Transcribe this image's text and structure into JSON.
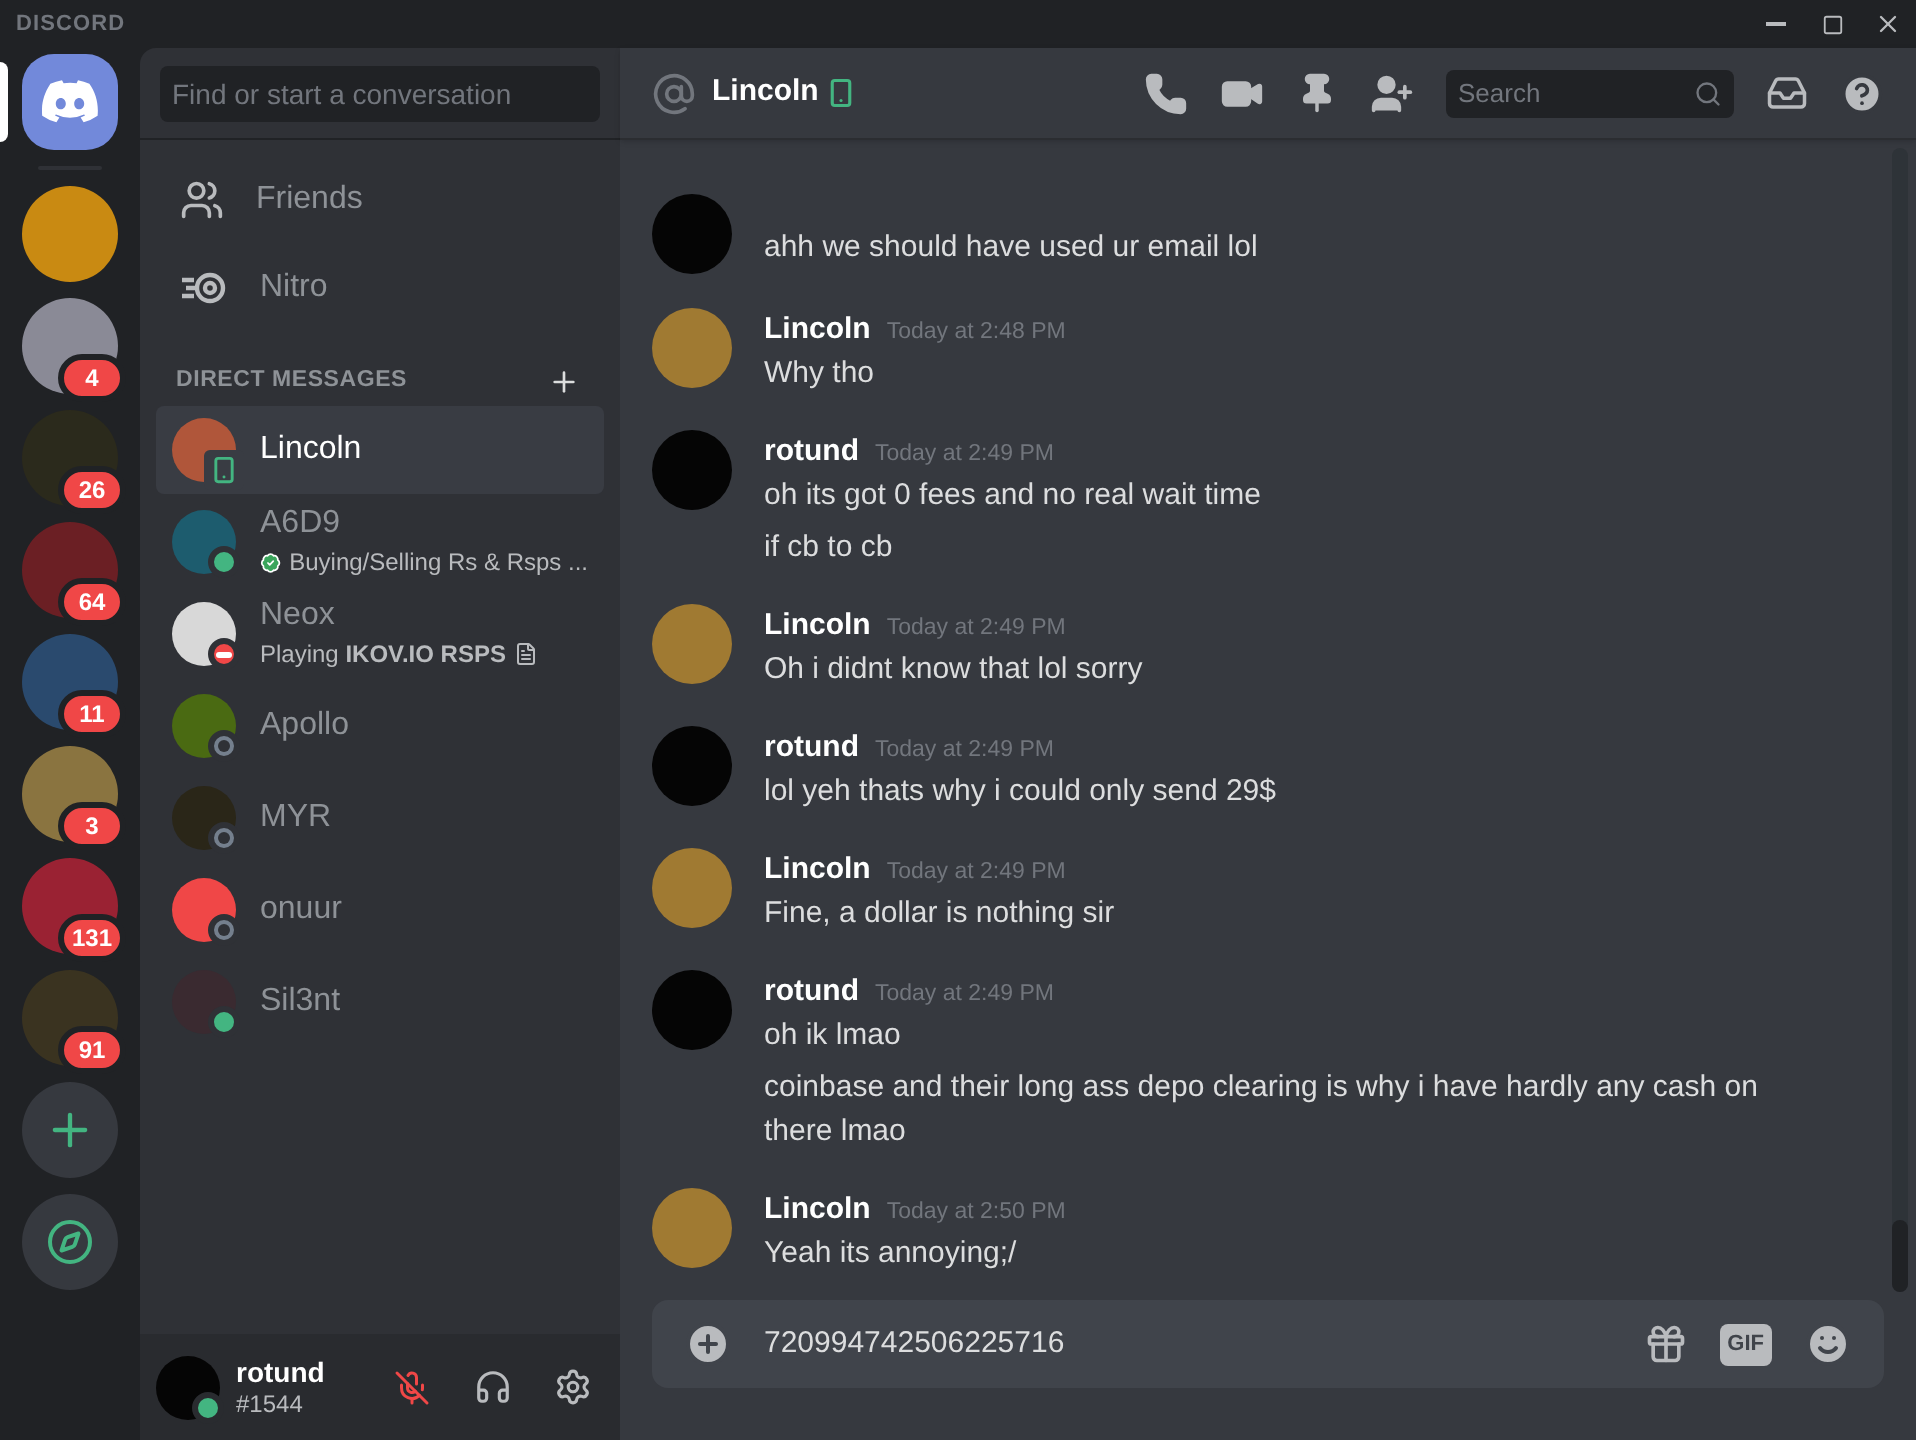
{
  "app_title": "DISCORD",
  "servers": [
    {
      "kind": "home",
      "selected": true
    },
    {
      "kind": "server",
      "color": "#c98a12"
    },
    {
      "kind": "server",
      "badge": "4",
      "color": "#8a8a96"
    },
    {
      "kind": "server",
      "badge": "26",
      "color": "#2b2a1c"
    },
    {
      "kind": "server",
      "badge": "64",
      "color": "#6b1f24"
    },
    {
      "kind": "server",
      "badge": "11",
      "color": "#2a4a6e"
    },
    {
      "kind": "server",
      "badge": "3",
      "color": "#8a7440"
    },
    {
      "kind": "server",
      "badge": "131",
      "color": "#9a2233"
    },
    {
      "kind": "server",
      "badge": "91",
      "color": "#3a3320"
    },
    {
      "kind": "add"
    },
    {
      "kind": "explore"
    }
  ],
  "dm_search": {
    "placeholder": "Find or start a conversation"
  },
  "nav": [
    {
      "kind": "friends",
      "label": "Friends"
    },
    {
      "kind": "nitro",
      "label": "Nitro"
    }
  ],
  "dm_header": "DIRECT MESSAGES",
  "dms": [
    {
      "name": "Lincoln",
      "selected": true,
      "status": {
        "kind": "mobile"
      },
      "color": "#b0563a"
    },
    {
      "name": "A6D9",
      "selected": false,
      "status": {
        "kind": "online"
      },
      "activity": {
        "text": "Buying/Selling Rs & Rsps ...",
        "kind": "verified"
      },
      "color": "#1d5c6e"
    },
    {
      "name": "Neox",
      "selected": false,
      "status": {
        "kind": "dnd"
      },
      "activity": {
        "text": "Playing **IKOV.IO RSPS**",
        "kind": "game"
      },
      "color": "#d8d8d8"
    },
    {
      "name": "Apollo",
      "selected": false,
      "status": {
        "kind": "offline"
      },
      "color": "#4a6a12"
    },
    {
      "name": "MYR",
      "selected": false,
      "status": {
        "kind": "offline"
      },
      "color": "#2a2618"
    },
    {
      "name": "onuur",
      "selected": false,
      "status": {
        "kind": "offline"
      },
      "color": "#f04747"
    },
    {
      "name": "Sil3nt",
      "selected": false,
      "status": {
        "kind": "online"
      },
      "color": "#3a2a30"
    }
  ],
  "user": {
    "name": "rotund",
    "tag": "#1544",
    "status": {
      "kind": "online"
    },
    "mic_muted": true
  },
  "channel": {
    "name": "Lincoln",
    "status": {
      "kind": "mobile"
    }
  },
  "search": {
    "placeholder": "Search"
  },
  "messages": [
    {
      "color": "#050505",
      "lines": [
        "ahh we should have used ur email lol"
      ]
    },
    {
      "author": "Lincoln",
      "color": "#a07a32",
      "time": "Today at 2:48 PM",
      "lines": [
        "Why tho"
      ]
    },
    {
      "author": "rotund",
      "color": "#050505",
      "time": "Today at 2:49 PM",
      "lines": [
        "oh its got 0 fees and no real wait time",
        "if cb to cb"
      ]
    },
    {
      "author": "Lincoln",
      "color": "#a07a32",
      "time": "Today at 2:49 PM",
      "lines": [
        "Oh i didnt know that lol sorry"
      ]
    },
    {
      "author": "rotund",
      "color": "#050505",
      "time": "Today at 2:49 PM",
      "lines": [
        "lol yeh thats why i could only send 29$"
      ]
    },
    {
      "author": "Lincoln",
      "color": "#a07a32",
      "time": "Today at 2:49 PM",
      "lines": [
        "Fine, a dollar is nothing sir"
      ]
    },
    {
      "author": "rotund",
      "color": "#050505",
      "time": "Today at 2:49 PM",
      "lines": [
        "oh ik lmao",
        "coinbase and their long ass depo clearing is why i have hardly any cash on there lmao"
      ]
    },
    {
      "author": "Lincoln",
      "color": "#a07a32",
      "time": "Today at 2:50 PM",
      "lines": [
        "Yeah its annoying;/"
      ]
    }
  ],
  "composer": {
    "value": "720994742506225716",
    "gif_label": "GIF"
  }
}
